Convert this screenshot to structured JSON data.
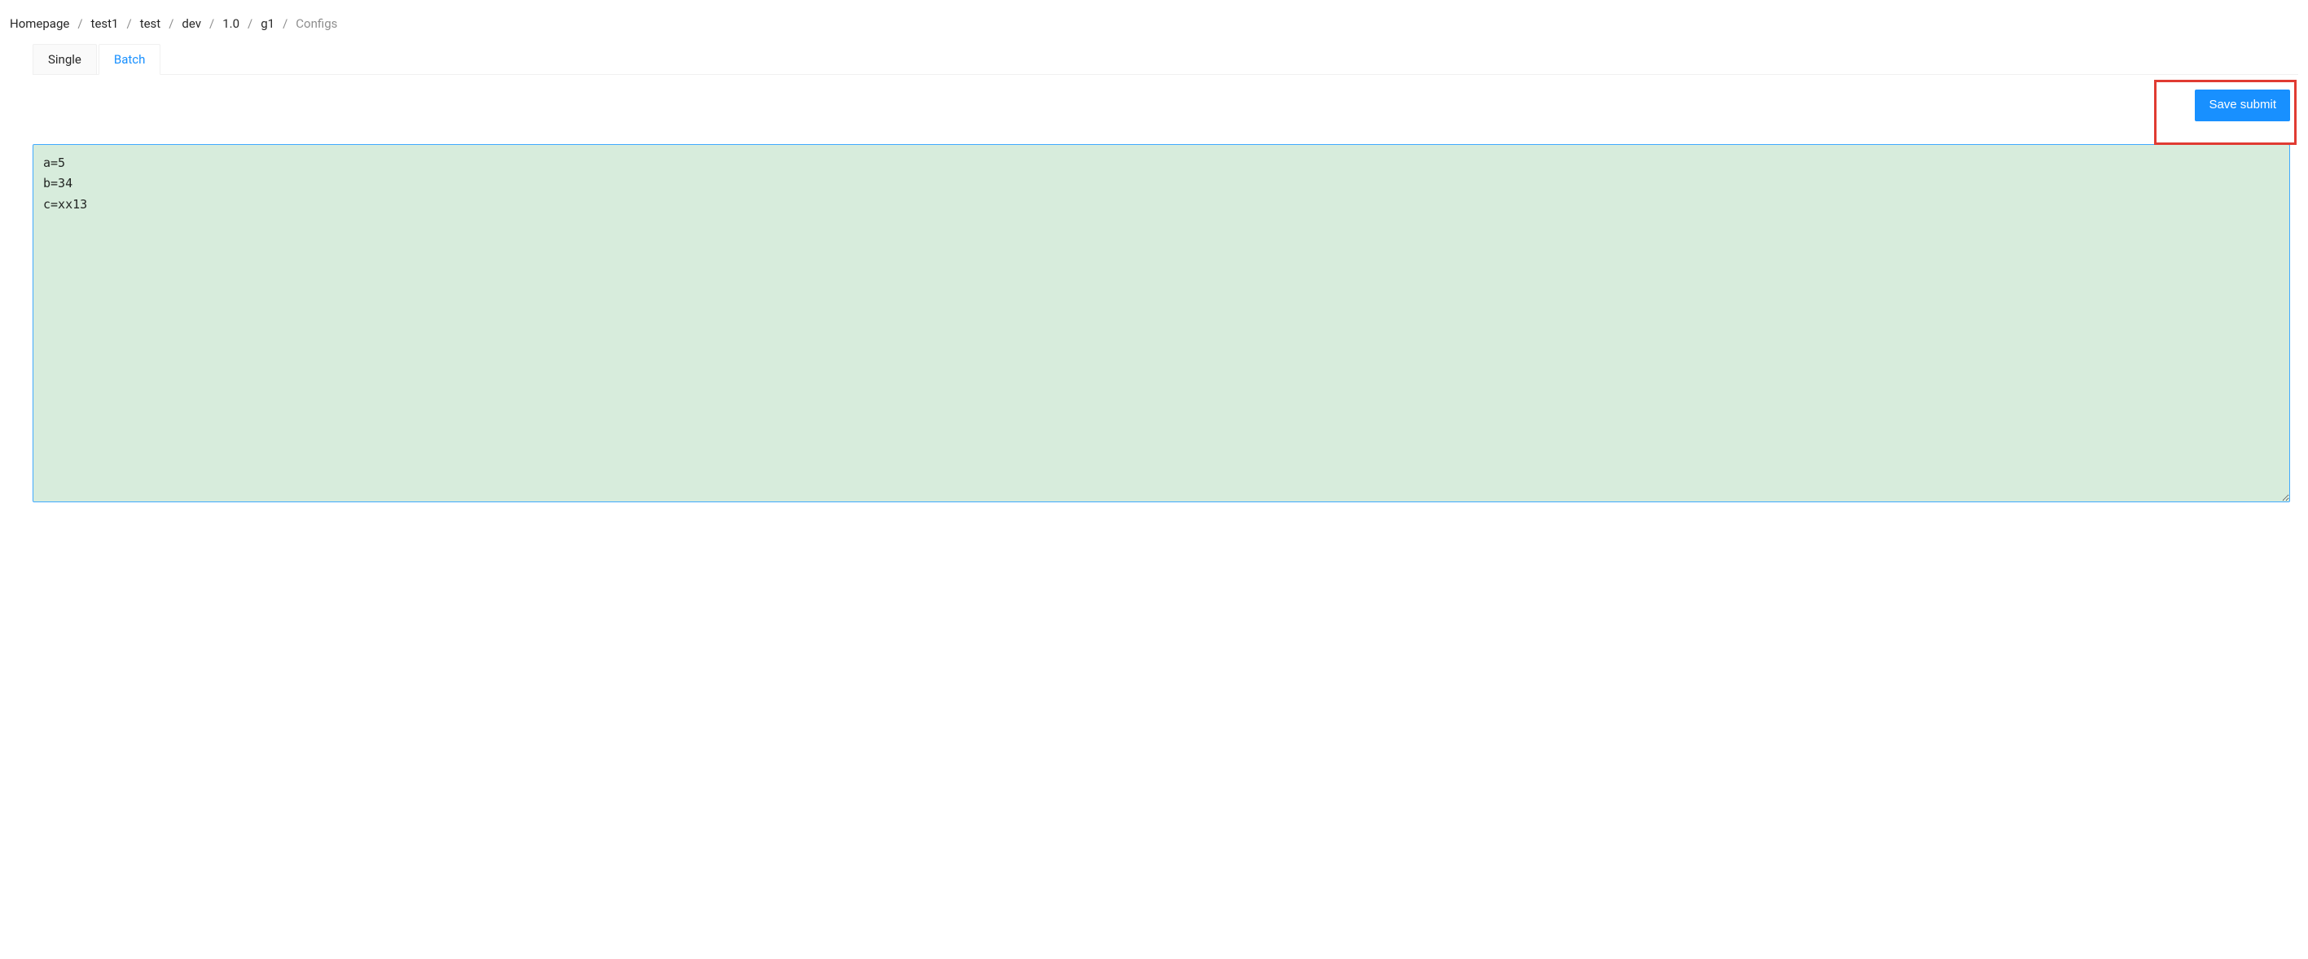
{
  "breadcrumb": {
    "items": [
      {
        "label": "Homepage"
      },
      {
        "label": "test1"
      },
      {
        "label": "test"
      },
      {
        "label": "dev"
      },
      {
        "label": "1.0"
      },
      {
        "label": "g1"
      },
      {
        "label": "Configs"
      }
    ]
  },
  "tabs": {
    "items": [
      {
        "label": "Single",
        "active": false
      },
      {
        "label": "Batch",
        "active": true
      }
    ]
  },
  "actions": {
    "save_submit_label": "Save submit"
  },
  "editor": {
    "value": "a=5\nb=34\nc=xx13"
  }
}
